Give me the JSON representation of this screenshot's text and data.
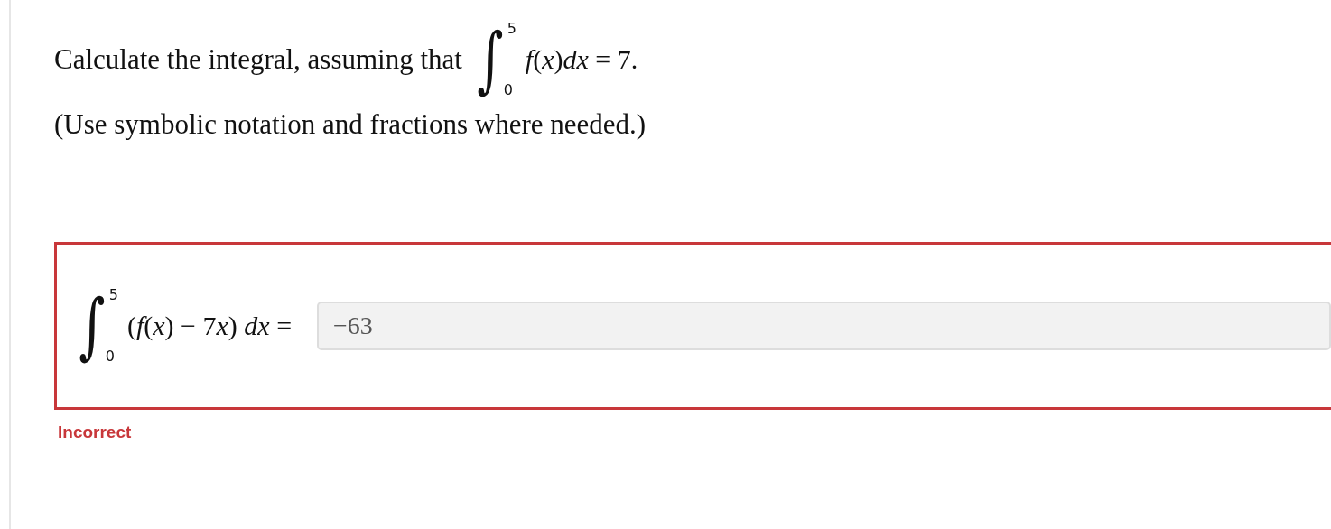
{
  "question": {
    "prompt": "Calculate the integral, assuming that",
    "integral": {
      "sign": "∫",
      "upper": "5",
      "lower": "0",
      "integrand": [
        {
          "text": "f",
          "italic": true
        },
        {
          "text": "(",
          "italic": false
        },
        {
          "text": "x",
          "italic": true
        },
        {
          "text": ")",
          "italic": false
        },
        {
          "text": "dx",
          "italic": true
        },
        {
          "text": " = 7.",
          "italic": false
        }
      ]
    },
    "hint": "(Use symbolic notation and fractions where needed.)"
  },
  "answer": {
    "correct": false,
    "integral": {
      "sign": "∫",
      "upper": "5",
      "lower": "0",
      "integrand": [
        {
          "text": "(",
          "italic": false
        },
        {
          "text": "f",
          "italic": true
        },
        {
          "text": "(",
          "italic": false
        },
        {
          "text": "x",
          "italic": true
        },
        {
          "text": ") − 7",
          "italic": false
        },
        {
          "text": "x",
          "italic": true
        },
        {
          "text": ") ",
          "italic": false
        },
        {
          "text": "dx",
          "italic": true
        },
        {
          "text": " =",
          "italic": false
        }
      ]
    },
    "value": "−63",
    "feedback": "Incorrect"
  }
}
